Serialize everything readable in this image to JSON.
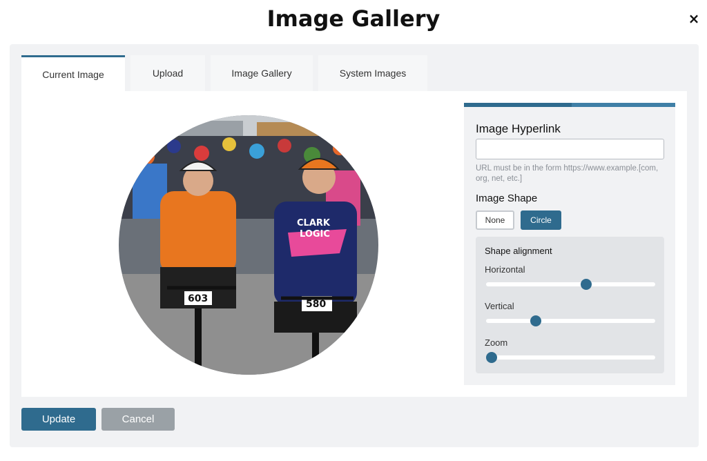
{
  "modal": {
    "title": "Image Gallery",
    "close_icon": "×"
  },
  "tabs": [
    {
      "label": "Current Image",
      "active": true
    },
    {
      "label": "Upload",
      "active": false
    },
    {
      "label": "Image Gallery",
      "active": false
    },
    {
      "label": "System Images",
      "active": false
    }
  ],
  "image": {
    "shape": "circle",
    "bib_numbers": [
      "603",
      "580"
    ],
    "jersey_text": [
      "CLARK",
      "LOGIC"
    ]
  },
  "hyperlink": {
    "heading": "Image Hyperlink",
    "value": "",
    "placeholder": "",
    "hint": "URL must be in the form https://www.example.[com, org, net, etc.]"
  },
  "shape": {
    "heading": "Image Shape",
    "none_label": "None",
    "circle_label": "Circle",
    "selected": "Circle"
  },
  "alignment": {
    "title": "Shape alignment",
    "horizontal_label": "Horizontal",
    "vertical_label": "Vertical",
    "zoom_label": "Zoom",
    "horizontal_value": 0.6,
    "vertical_value": 0.28,
    "zoom_value": 0.0
  },
  "actions": {
    "update_label": "Update",
    "cancel_label": "Cancel"
  },
  "colors": {
    "accent": "#2f6b8e",
    "panel": "#f1f2f4",
    "cancel": "#9aa1a6"
  }
}
